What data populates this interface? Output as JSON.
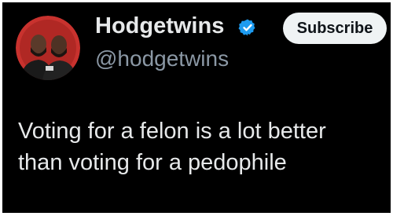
{
  "author": {
    "display_name": "Hodgetwins",
    "handle": "@hodgetwins",
    "verified_icon": "verified-badge-icon",
    "avatar": "avatar-photo"
  },
  "actions": {
    "subscribe_label": "Subscribe"
  },
  "tweet": {
    "lines": [
      "Voting for a felon is a lot better",
      "than voting for a pedophile"
    ]
  },
  "colors": {
    "background": "#000000",
    "text_primary": "#e7e9ea",
    "text_secondary": "#8b98a5",
    "verified_blue": "#1d9bf0",
    "avatar_ring": "#c8322e",
    "button_bg": "#eff3f4"
  }
}
